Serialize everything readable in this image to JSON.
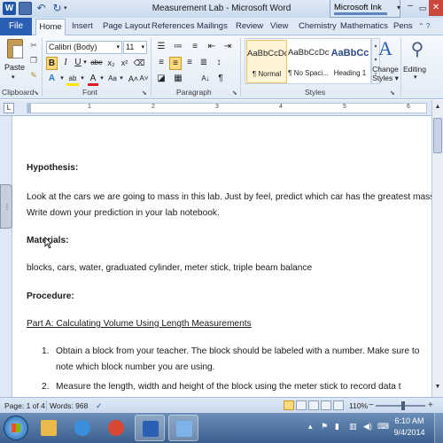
{
  "window": {
    "title": "Measurement Lab - Microsoft Word",
    "word_icon": "W",
    "ink_app_title": "Microsoft Ink"
  },
  "tabs": [
    "File",
    "Home",
    "Insert",
    "Page Layout",
    "References",
    "Mailings",
    "Review",
    "View",
    "Chemistry",
    "Mathematics",
    "Pens"
  ],
  "ribbon": {
    "clipboard": {
      "paste_label": "Paste",
      "group_label": "Clipboard"
    },
    "font": {
      "font_name": "Calibri (Body)",
      "font_size": "11",
      "grow": "A˄",
      "shrink": "A˅",
      "case": "Aa",
      "clear": "Ⓐ",
      "bold": "B",
      "italic": "I",
      "underline": "U",
      "strike": "abe",
      "subscript": "x₂",
      "superscript": "x²",
      "text_effects": "A",
      "highlight": "ab",
      "font_color": "A",
      "group_label": "Font"
    },
    "paragraph": {
      "group_label": "Paragraph",
      "pilcrow": "¶",
      "sort": "A↓"
    },
    "styles": {
      "items": [
        {
          "sample": "AaBbCcDc",
          "name": "¶ Normal"
        },
        {
          "sample": "AaBbCcDc",
          "name": "¶ No Spaci..."
        },
        {
          "sample": "AaBbCс",
          "name": "Heading 1"
        }
      ],
      "change_styles": "Change Styles",
      "change_styles_l1": "Change",
      "change_styles_l2": "Styles ▾",
      "group_label": "Styles"
    },
    "editing": {
      "label": "Editing"
    }
  },
  "document": {
    "lines": [
      {
        "text": "Hypothesis:",
        "style": "bold"
      },
      {
        "text": "Look at the cars we are going to mass in this lab. Just by feel, predict which car has the greatest mass.",
        "style": "normal"
      },
      {
        "text": "Write down your prediction in your lab notebook.",
        "style": "normal"
      },
      {
        "text": "Materials:",
        "style": "bold"
      },
      {
        "text": "blocks, cars, water, graduated cylinder, meter stick, triple beam balance",
        "style": "normal"
      },
      {
        "text": "Procedure:",
        "style": "bold"
      },
      {
        "text": "Part A: Calculating Volume Using Length Measurements",
        "style": "underline"
      },
      {
        "text": "1.",
        "style": "normal"
      },
      {
        "text": "Obtain a block from your teacher. The block should be labeled with a number. Make sure to",
        "style": "normal"
      },
      {
        "text": "note which block number you are using.",
        "style": "normal"
      },
      {
        "text": "2.",
        "style": "normal"
      },
      {
        "text": "Measure the length, width and height of the block using the meter stick to record data t",
        "style": "normal"
      }
    ]
  },
  "ruler": {
    "numbers": [
      "1",
      "2",
      "3",
      "4",
      "5",
      "6"
    ]
  },
  "status": {
    "page": "Page: 1 of 4",
    "words": "Words: 968",
    "zoom": "110%",
    "zoom_level": 0.55,
    "minus": "−",
    "plus": "+"
  },
  "taskbar": {
    "apps": [
      {
        "name": "file-explorer",
        "color": "#e9b949"
      },
      {
        "name": "internet-explorer",
        "color": "#3a8fdc"
      },
      {
        "name": "chrome",
        "color": "#d94735"
      },
      {
        "name": "word",
        "color": "#2b5fb4"
      },
      {
        "name": "journal",
        "color": "#7fb2e8"
      }
    ],
    "time": "6:10 AM",
    "date": "9/4/2014"
  }
}
